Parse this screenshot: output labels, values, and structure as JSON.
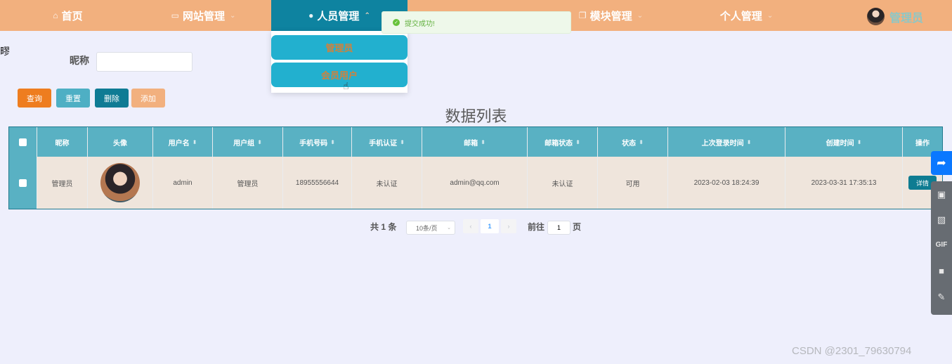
{
  "nav": {
    "items": [
      {
        "label": "首页"
      },
      {
        "label": "网站管理"
      },
      {
        "label": "人员管理"
      },
      {
        "label": "模块管理"
      },
      {
        "label": "个人管理"
      }
    ],
    "user_name": "管理员",
    "dropdown": [
      "管理员",
      "会员用户"
    ]
  },
  "toast": {
    "message": "提交成功!"
  },
  "stray_text": "疁",
  "search": {
    "label": "昵称",
    "value": ""
  },
  "buttons": {
    "query": "查询",
    "reset": "重置",
    "delete": "删除",
    "add": "添加"
  },
  "list_title": "数据列表",
  "table": {
    "headers": [
      "昵称",
      "头像",
      "用户名",
      "用户组",
      "手机号码",
      "手机认证",
      "邮箱",
      "邮箱状态",
      "状态",
      "上次登录时间",
      "创建时间",
      "操作"
    ],
    "rows": [
      {
        "nickname": "管理员",
        "username": "admin",
        "group": "管理员",
        "phone": "18955556644",
        "phone_verify": "未认证",
        "email": "admin@qq.com",
        "email_status": "未认证",
        "status": "可用",
        "last_login": "2023-02-03 18:24:39",
        "created": "2023-03-31 17:35:13",
        "action": "详情"
      }
    ]
  },
  "pagination": {
    "total": "共 1 条",
    "page_size": "10条/页",
    "current": "1",
    "goto_label": "前往",
    "goto_value": "1",
    "page_suffix": "页"
  },
  "watermark": "CSDN @2301_79630794",
  "colors": {
    "nav_bg": "#f2b07e",
    "nav_active": "#0e83a0",
    "table_header": "#59b1c3",
    "row_bg": "#efe5dc"
  }
}
